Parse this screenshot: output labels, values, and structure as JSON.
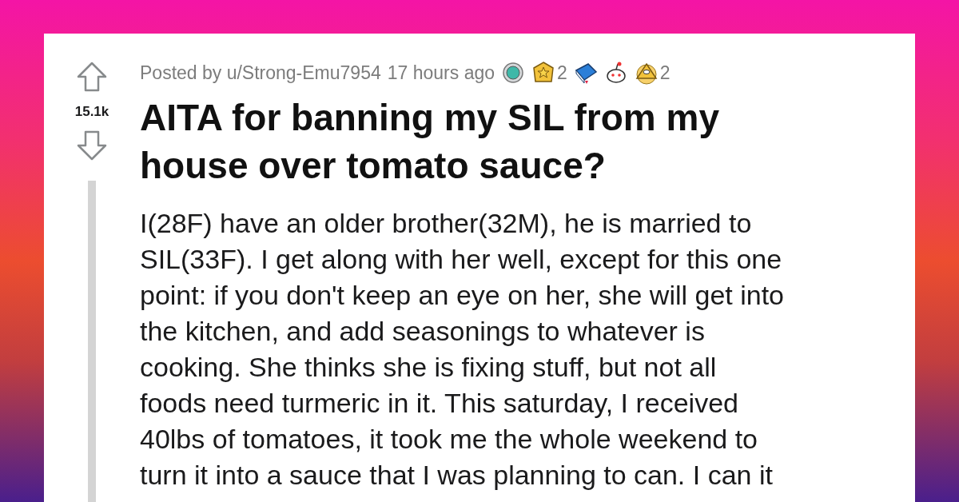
{
  "post": {
    "posted_by": "Posted by u/Strong-Emu7954",
    "time": "17 hours ago",
    "awards": [
      {
        "kind": "medal"
      },
      {
        "kind": "star",
        "count": "2"
      },
      {
        "kind": "book"
      },
      {
        "kind": "alien"
      },
      {
        "kind": "pyramid",
        "count": "2"
      }
    ],
    "score": "15.1k",
    "title": "AITA for banning my SIL from my house over tomato sauce?",
    "body_lines": [
      "I(28F) have an older brother(32M), he is married to",
      "SIL(33F). I get along with her well, except for this one",
      "point: if you don't keep an eye on her, she will get into",
      "the kitchen, and add seasonings to whatever is",
      "cooking. She thinks she is fixing stuff, but not all",
      "foods need turmeric in it. This saturday, I received",
      "40lbs of tomatoes, it took me the whole weekend to",
      "turn it into a sauce that I was planning to can. I can it"
    ]
  }
}
